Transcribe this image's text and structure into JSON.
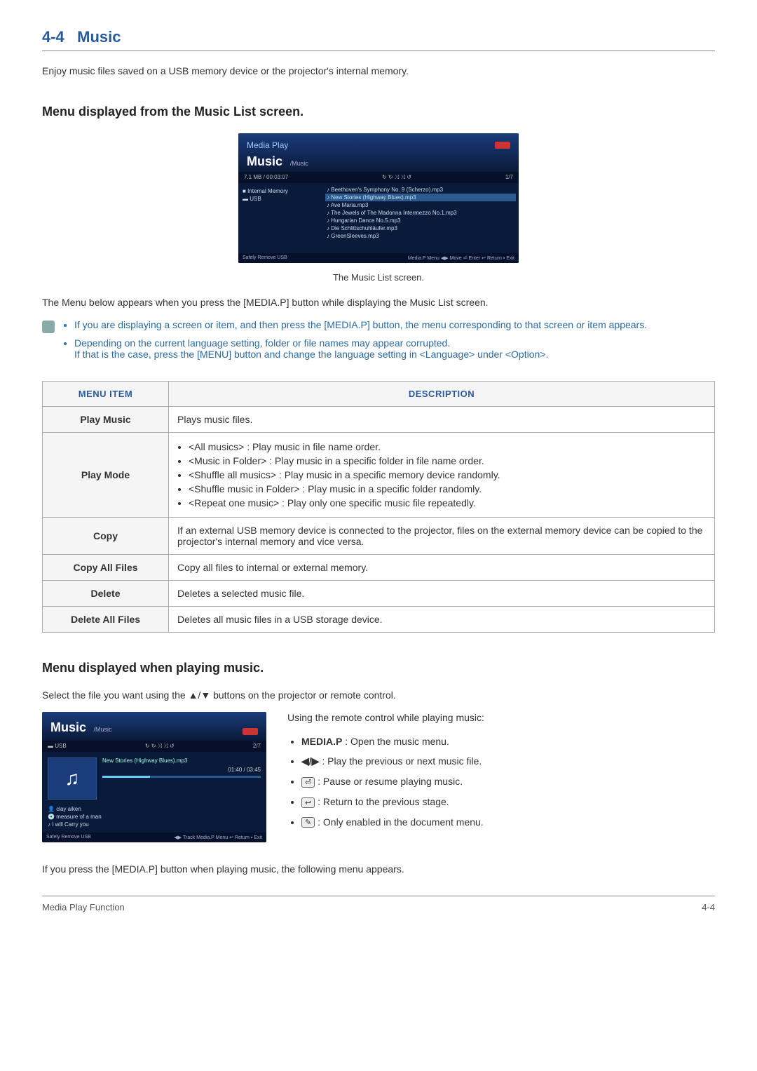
{
  "section": {
    "number": "4-4",
    "title": "Music"
  },
  "intro": "Enjoy music files saved on a USB memory device or the projector's internal memory.",
  "heading1": "Menu displayed from the Music List screen.",
  "screenshot1": {
    "mediaPlay": "Media Play",
    "music": "Music",
    "path": "/Music",
    "barLeft": "7.1 MB / 00:03:07",
    "barRight": "1/7",
    "side": {
      "internal": "Internal Memory",
      "usb": "USB"
    },
    "files": [
      "Beethoven's Symphony No. 9 (Scherzo).mp3",
      "New Stories (Highway Blues).mp3",
      "Ave Maria.mp3",
      "The Jewels of The Madonna Intermezzo No.1.mp3",
      "Hungarian Dance No.5.mp3",
      "Die Schlittschuhläufer.mp3",
      "GreenSleeves.mp3"
    ],
    "footerLeft": "Safely Remove USB",
    "footerRight": "Media.P Menu ◀▶ Move ⏎ Enter ↩ Return ▪ Exit"
  },
  "caption1": "The Music List screen.",
  "para1": "The Menu below appears when you press the [MEDIA.P] button while displaying the Music List screen.",
  "notes": {
    "n1": "If you are displaying a screen or item, and then press the [MEDIA.P] button, the menu corresponding to that screen or item appears.",
    "n2a": "Depending on the current language setting, folder or file names may appear corrupted.",
    "n2b": "If that is the case, press the [MENU] button and change the language setting in <Language> under <Option>."
  },
  "table": {
    "h1": "MENU ITEM",
    "h2": "DESCRIPTION",
    "rows": {
      "playMusic": {
        "label": "Play Music",
        "desc": "Plays music files."
      },
      "playMode": {
        "label": "Play Mode",
        "items": [
          "<All musics> : Play music in file name order.",
          "<Music in Folder> : Play music in a specific folder in file name order.",
          "<Shuffle all musics> : Play music in a specific memory device randomly.",
          "<Shuffle music in Folder> : Play music in a specific folder randomly.",
          "<Repeat one music> : Play only one specific music file repeatedly."
        ]
      },
      "copy": {
        "label": "Copy",
        "desc": "If an external USB memory device is connected to the projector, files on the external memory device can be copied to the projector's internal memory and vice versa."
      },
      "copyAll": {
        "label": "Copy All Files",
        "desc": "Copy all files to internal or external memory."
      },
      "delete": {
        "label": "Delete",
        "desc": "Deletes a selected music file."
      },
      "deleteAll": {
        "label": "Delete All Files",
        "desc": "Deletes all music files in a USB storage device."
      }
    }
  },
  "heading2": "Menu displayed when playing music.",
  "para2": "Select the file you want using the ▲/▼ buttons on the projector or remote control.",
  "screenshot2": {
    "music": "Music",
    "path": "/Music",
    "barLeft": "USB",
    "barRight": "2/7",
    "track": "New Stories (Highway Blues).mp3",
    "time": "01:40 / 03:45",
    "meta": {
      "artist": "clay aiken",
      "album": "measure of a man",
      "song": "I will Carry you"
    },
    "footerLeft": "Safely Remove USB",
    "footerRight": "◀▶ Track  Media.P Menu  ↩ Return ▪ Exit"
  },
  "remote": {
    "intro": "Using the remote control while playing music:",
    "items": {
      "mediap": {
        "key": "MEDIA.P",
        "desc": " : Open the music menu."
      },
      "prevnext": {
        "key": "◀/▶",
        "desc": " : Play the previous or next music file."
      },
      "enter": {
        "key": "⏎",
        "desc": " : Pause or resume playing music."
      },
      "return": {
        "key": "↩",
        "desc": " : Return to the previous stage."
      },
      "doc": {
        "key": "✎",
        "desc": " : Only enabled in the document menu."
      }
    }
  },
  "para3": "If you press the [MEDIA.P] button when playing music, the following menu appears.",
  "footer": {
    "left": "Media Play Function",
    "right": "4-4"
  }
}
